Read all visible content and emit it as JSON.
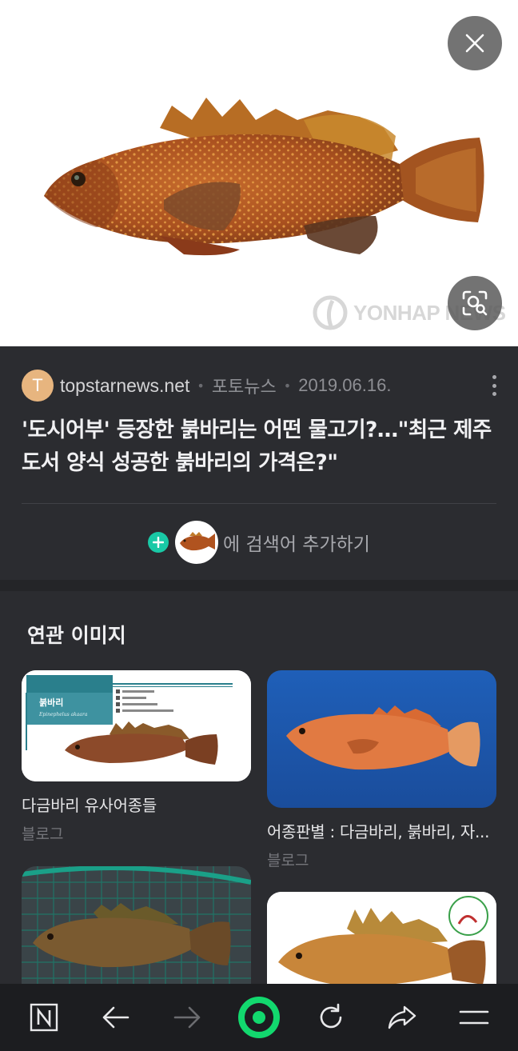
{
  "hero": {
    "watermark": "YONHAP NEWS",
    "close_icon": "close-icon",
    "lens_icon": "image-search-icon"
  },
  "article": {
    "source_initial": "T",
    "source_name": "topstarnews.net",
    "category": "포토뉴스",
    "date": "2019.06.16.",
    "headline": "'도시어부' 등장한 붉바리는 어떤 물고기?…\"최근 제주도서 양식 성공한 붉바리의 가격은?\"",
    "add_keyword_label": "에 검색어 추가하기",
    "colors": {
      "avatar": "#e7b57f",
      "accent": "#19c9a6"
    }
  },
  "related": {
    "title": "연관 이미지",
    "cards": [
      {
        "caption": "다금바리 유사어종들",
        "source": "블로그",
        "chart_label": "붉바리",
        "chart_sci": "Epinephelus akaara"
      },
      {
        "caption": "어종판별 : 다금바리, 붉바리, 자...",
        "source": "블로그"
      },
      {
        "caption": "",
        "source": ""
      },
      {
        "caption": "",
        "source": ""
      }
    ]
  },
  "toolbar": {
    "items": [
      "home-n-icon",
      "back-arrow-icon",
      "forward-arrow-icon",
      "green-dot-icon",
      "refresh-icon",
      "share-icon",
      "menu-icon"
    ]
  }
}
